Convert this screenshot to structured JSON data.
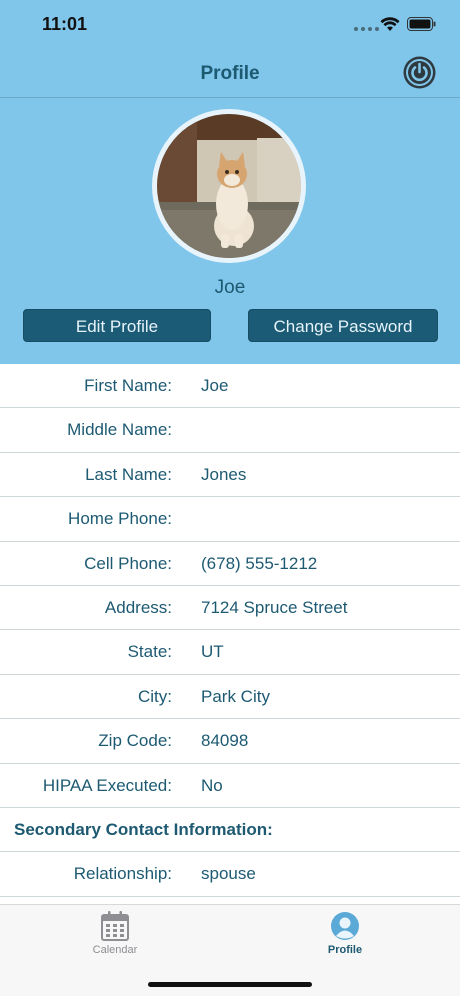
{
  "status_bar": {
    "time": "11:01"
  },
  "nav": {
    "title": "Profile",
    "power_icon": "power-icon"
  },
  "header": {
    "name": "Joe",
    "edit_button": "Edit Profile",
    "password_button": "Change Password",
    "avatar_alt": "cat-photo"
  },
  "details": {
    "first_name": {
      "label": "First Name:",
      "value": "Joe"
    },
    "middle_name": {
      "label": "Middle Name:",
      "value": ""
    },
    "last_name": {
      "label": "Last Name:",
      "value": "Jones"
    },
    "home_phone": {
      "label": "Home Phone:",
      "value": ""
    },
    "cell_phone": {
      "label": "Cell Phone:",
      "value": "(678) 555-1212"
    },
    "address": {
      "label": "Address:",
      "value": "7124 Spruce Street"
    },
    "state": {
      "label": "State:",
      "value": "UT"
    },
    "city": {
      "label": "City:",
      "value": "Park City"
    },
    "zip": {
      "label": "Zip Code:",
      "value": "84098"
    },
    "hipaa": {
      "label": "HIPAA Executed:",
      "value": "No"
    },
    "secondary_section": "Secondary Contact Information:",
    "relationship": {
      "label": "Relationship:",
      "value": "spouse"
    }
  },
  "tabs": {
    "calendar": {
      "label": "Calendar",
      "icon": "calendar-icon"
    },
    "profile": {
      "label": "Profile",
      "icon": "person-icon"
    }
  },
  "colors": {
    "header_bg": "#80c6ea",
    "accent": "#1d5a72",
    "button_bg": "#1b5b75"
  }
}
